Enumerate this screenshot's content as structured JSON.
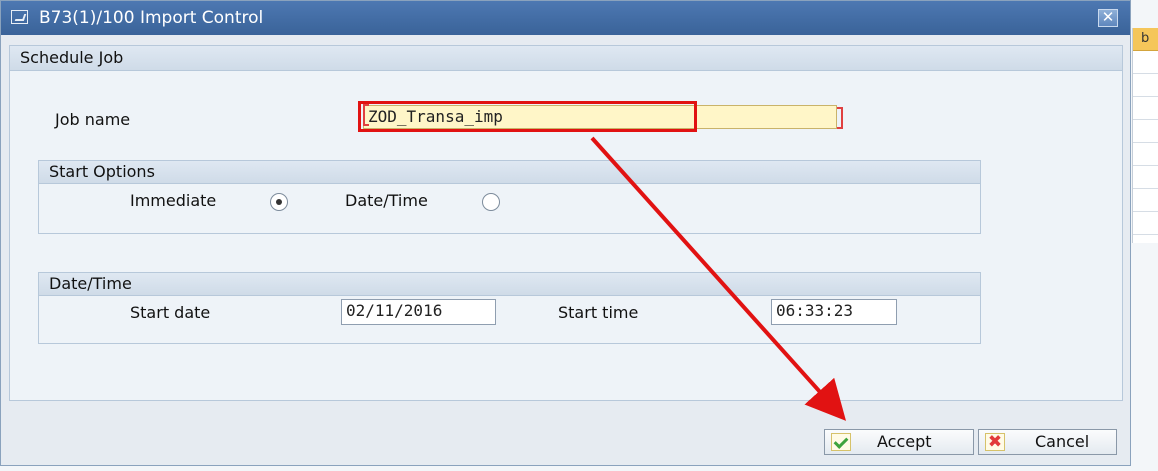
{
  "window": {
    "title": "B73(1)/100 Import Control",
    "close_symbol": "✕"
  },
  "background": {
    "grid_header_fragment": "b"
  },
  "schedule_job": {
    "title": "Schedule Job",
    "job_name_label": "Job name",
    "job_name_value": "ZOD_Transa_imp"
  },
  "start_options": {
    "title": "Start Options",
    "immediate_label": "Immediate",
    "immediate_selected": true,
    "datetime_label": "Date/Time",
    "datetime_selected": false
  },
  "date_time": {
    "title": "Date/Time",
    "start_date_label": "Start date",
    "start_date_value": "02/11/2016",
    "start_time_label": "Start time",
    "start_time_value": "06:33:23"
  },
  "buttons": {
    "accept_label": "Accept",
    "cancel_label": "Cancel"
  },
  "icons": {
    "title": "dialog-window-icon",
    "accept": "check-icon",
    "cancel": "cancel-x-icon"
  },
  "colors": {
    "titlebar": "#3a6399",
    "annotation_red": "#e11212",
    "job_input_bg": "#fff6c8"
  }
}
